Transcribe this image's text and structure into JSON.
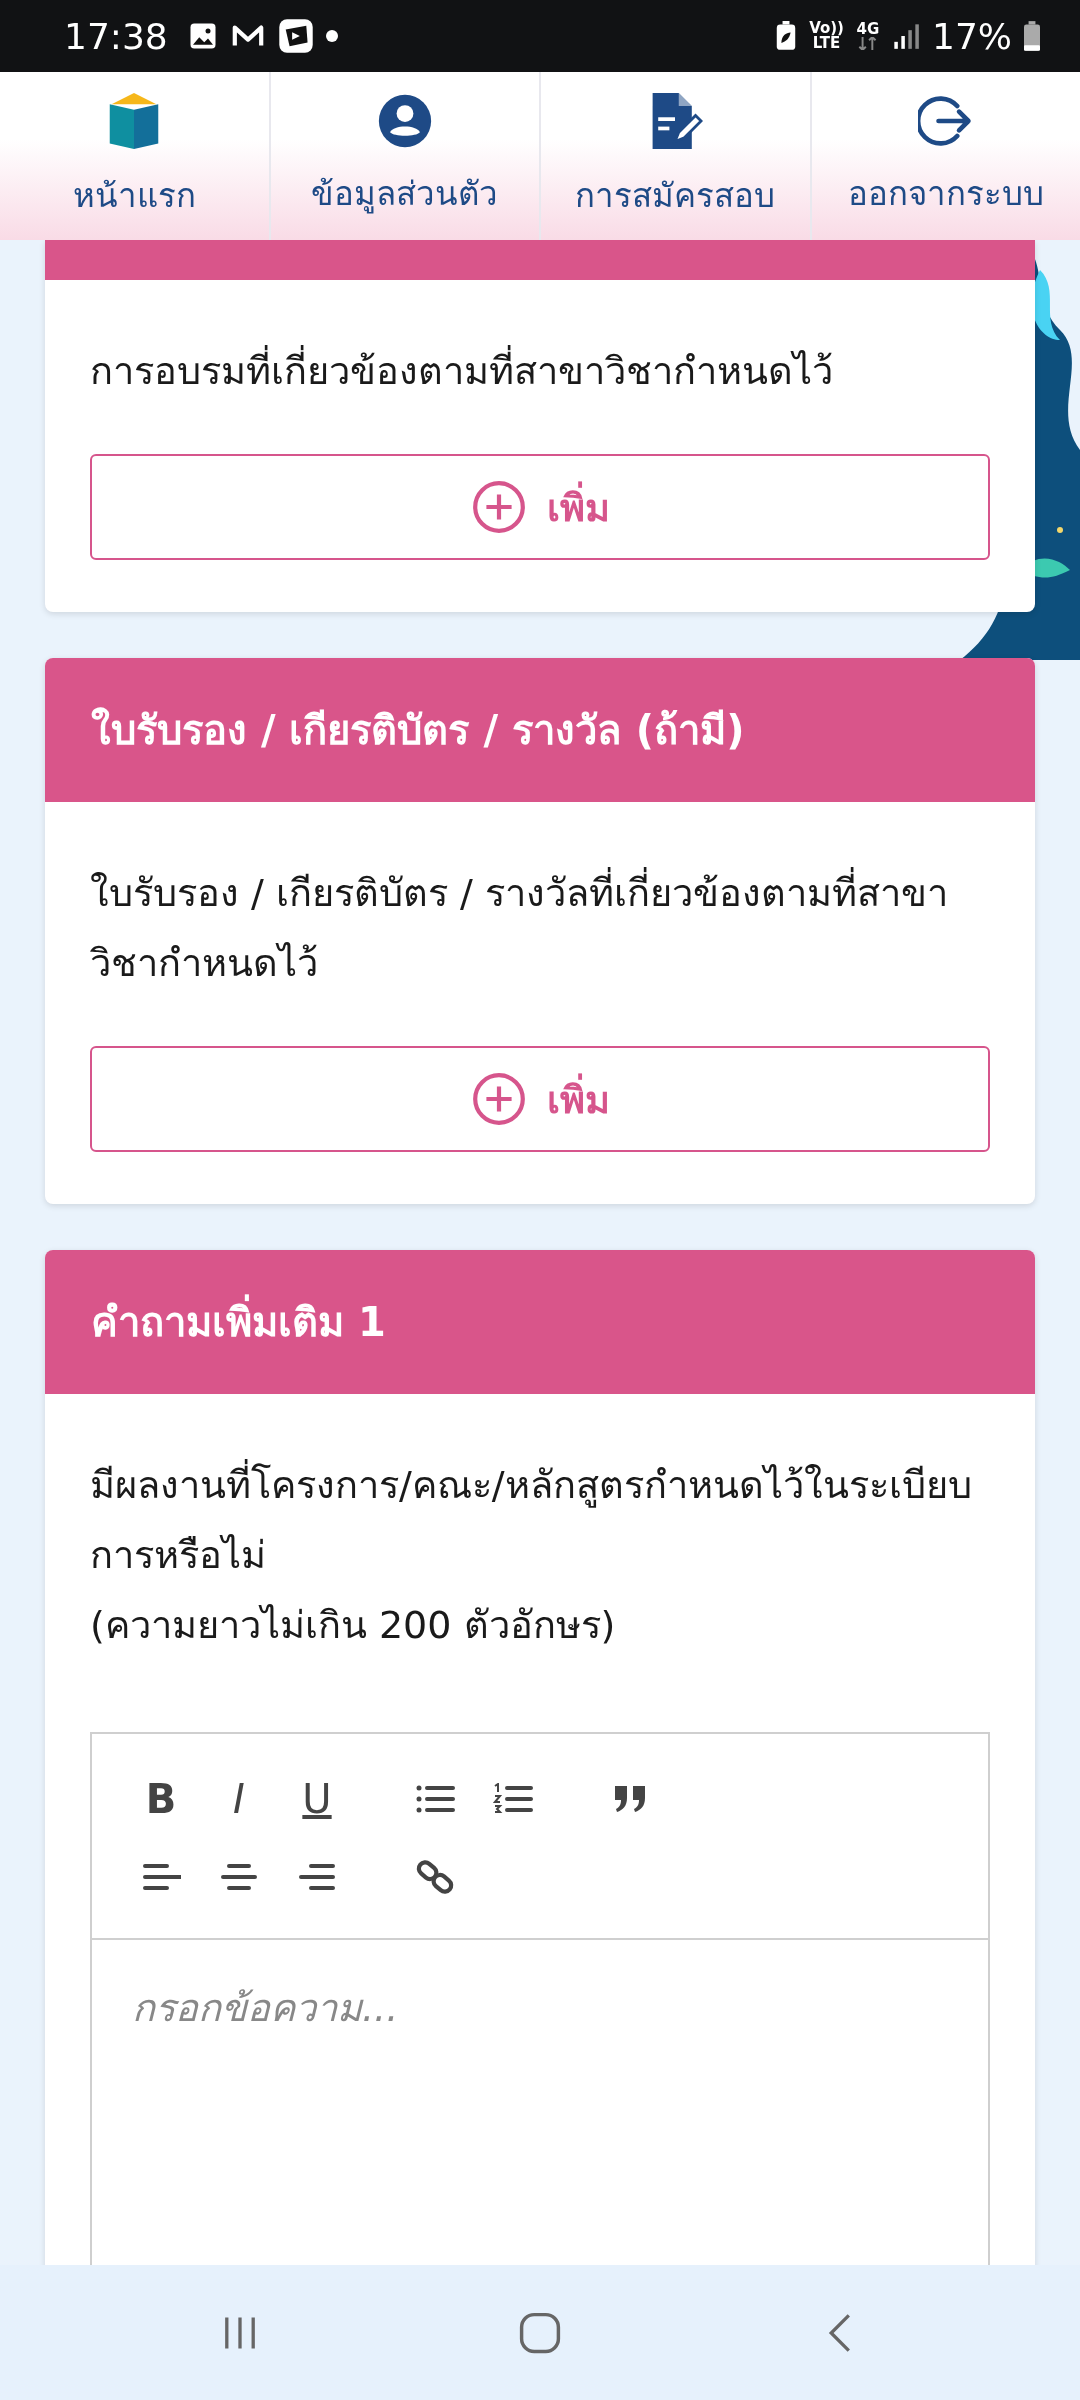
{
  "status_bar": {
    "time": "17:38",
    "voice": "Vo))",
    "lte": "LTE",
    "network": "4G",
    "battery": "17%"
  },
  "nav": [
    {
      "label": "หน้าแรก",
      "kind": "home"
    },
    {
      "label": "ข้อมูลส่วนตัว",
      "kind": "profile"
    },
    {
      "label": "การสมัครสอบ",
      "kind": "application"
    },
    {
      "label": "ออกจากระบบ",
      "kind": "logout"
    }
  ],
  "partial_section": {
    "description": "การอบรมที่เกี่ยวข้องตามที่สาขาวิชากำหนดไว้",
    "add_button": "เพิ่ม"
  },
  "sections": [
    {
      "kind": "add",
      "title": "ใบรับรอง / เกียรติบัตร / รางวัล (ถ้ามี)",
      "description": "ใบรับรอง / เกียรติบัตร / รางวัลที่เกี่ยวข้องตามที่สาขาวิชากำหนดไว้",
      "add_button": "เพิ่ม"
    },
    {
      "kind": "editor",
      "title": "คำถามเพิ่มเติม 1",
      "description": "มีผลงานที่โครงการ/คณะ/หลักสูตรกำหนดไว้ในระเบียบการหรือไม่",
      "note": "(ความยาวไม่เกิน 200 ตัวอักษร)",
      "editor": {
        "placeholder": "กรอกข้อความ...",
        "toolbar_rows": [
          [
            [
              {
                "kind": "bold",
                "label": "B"
              },
              {
                "kind": "italic",
                "label": "I"
              },
              {
                "kind": "underline",
                "label": "U"
              }
            ],
            [
              {
                "kind": "bullet_list"
              },
              {
                "kind": "ordered_list"
              }
            ],
            [
              {
                "kind": "quote"
              }
            ]
          ],
          [
            [
              {
                "kind": "align_left"
              },
              {
                "kind": "align_center"
              },
              {
                "kind": "align_right"
              }
            ],
            [
              {
                "kind": "link"
              }
            ]
          ]
        ]
      }
    }
  ]
}
